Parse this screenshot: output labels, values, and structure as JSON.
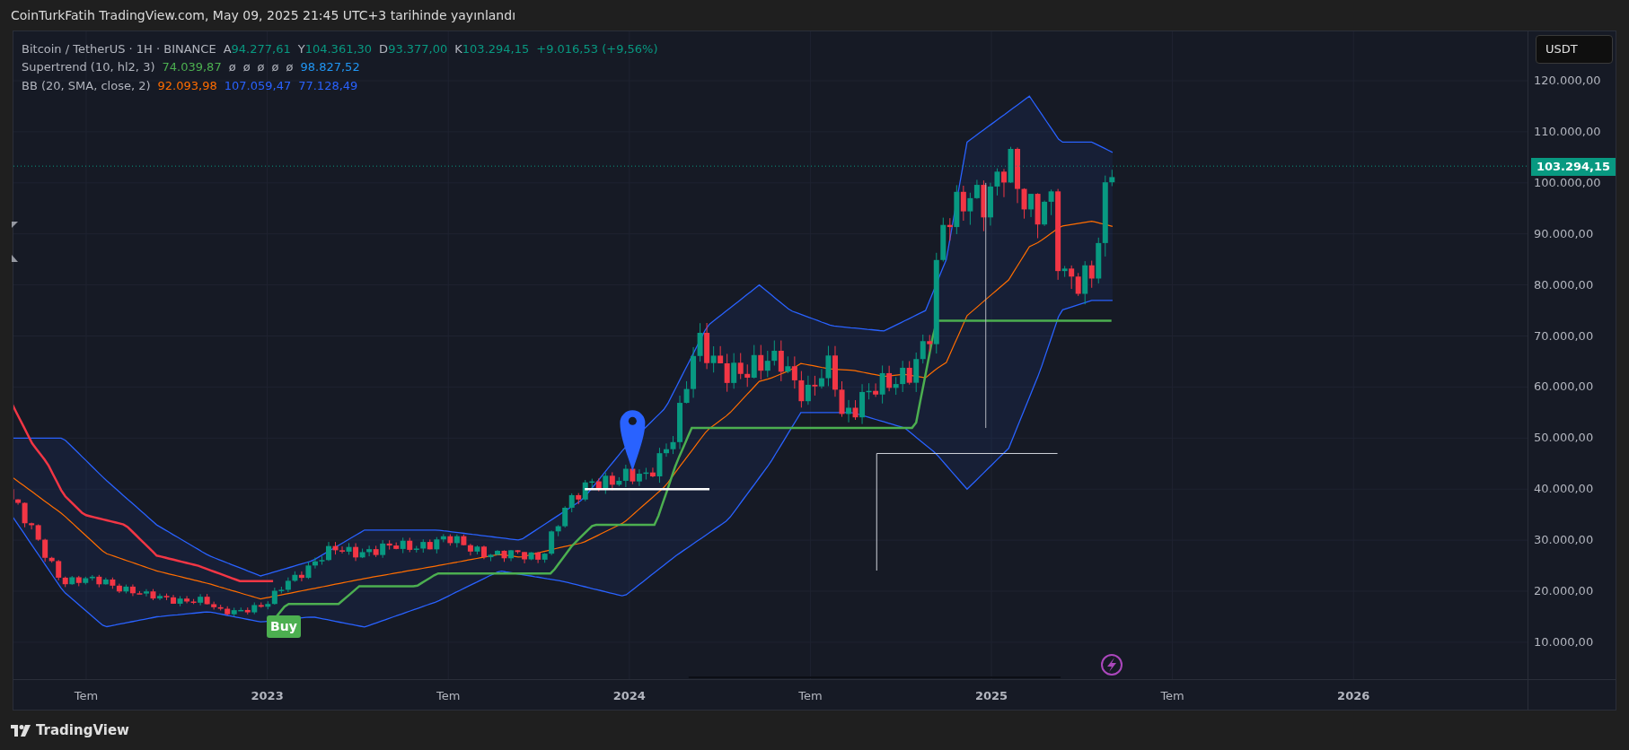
{
  "header": {
    "text": "CoinTurkFatih TradingView.com, May 09, 2025 21:45 UTC+3 tarihinde yayınlandı"
  },
  "legend": {
    "symbol": "Bitcoin / TetherUS · 1H · BINANCE",
    "ohlc": [
      {
        "label": "A",
        "value": "94.277,61"
      },
      {
        "label": "Y",
        "value": "104.361,30"
      },
      {
        "label": "D",
        "value": "93.377,00"
      },
      {
        "label": "K",
        "value": "103.294,15"
      }
    ],
    "change": "+9.016,53 (+9,56%)"
  },
  "indicators": [
    {
      "name": "Supertrend (10, hl2, 3)",
      "values": [
        {
          "text": "74.039,87",
          "color": "#4caf50"
        },
        {
          "text": "ø",
          "color": "#b2b5be"
        },
        {
          "text": "ø",
          "color": "#b2b5be"
        },
        {
          "text": "ø",
          "color": "#b2b5be"
        },
        {
          "text": "ø",
          "color": "#b2b5be"
        },
        {
          "text": "ø",
          "color": "#b2b5be"
        },
        {
          "text": "98.827,52",
          "color": "#2196f3"
        }
      ]
    },
    {
      "name": "BB (20, SMA, close, 2)",
      "values": [
        {
          "text": "92.093,98",
          "color": "#ff6d00"
        },
        {
          "text": "107.059,47",
          "color": "#2962ff"
        },
        {
          "text": "77.128,49",
          "color": "#2962ff"
        }
      ]
    }
  ],
  "currency_button": "USDT",
  "price_axis": {
    "labels": [
      "120.000,00",
      "110.000,00",
      "100.000,00",
      "90.000,00",
      "80.000,00",
      "70.000,00",
      "60.000,00",
      "50.000,00",
      "40.000,00",
      "30.000,00",
      "20.000,00",
      "10.000,00"
    ],
    "last_price": "103.294,15"
  },
  "time_axis": {
    "labels": [
      {
        "text": "Tem",
        "kind": "month"
      },
      {
        "text": "2023",
        "kind": "year"
      },
      {
        "text": "Tem",
        "kind": "month"
      },
      {
        "text": "2024",
        "kind": "year"
      },
      {
        "text": "Tem",
        "kind": "month"
      },
      {
        "text": "2025",
        "kind": "year"
      },
      {
        "text": "Tem",
        "kind": "month"
      },
      {
        "text": "2026",
        "kind": "year"
      }
    ]
  },
  "signal": {
    "text": "Buy"
  },
  "footer": {
    "logo_text": "TradingView"
  }
}
